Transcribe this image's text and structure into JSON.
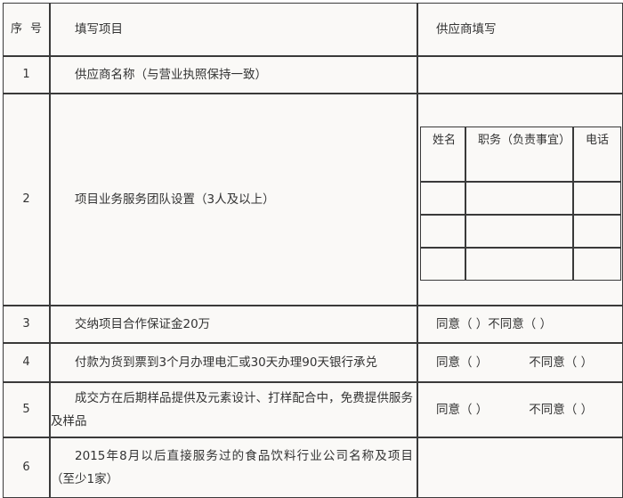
{
  "table": {
    "columns": {
      "seq_header": "序号",
      "item_header": "填写项目",
      "supplier_header": "供应商填写"
    },
    "rows": [
      {
        "seq": "1",
        "item": "供应商名称（与营业执照保持一致）",
        "supplier": ""
      },
      {
        "seq": "2",
        "item": "项目业务服务团队设置（3人及以上）",
        "supplier": ""
      },
      {
        "seq": "3",
        "item": "交纳项目合作保证金20万",
        "supplier": "同意（ ）不同意（ ）",
        "supplier_agree": "同意（ ）",
        "supplier_disagree": "不同意（ ）"
      },
      {
        "seq": "4",
        "item": "付款为货到票到3个月办理电汇或30天办理90天银行承兑",
        "supplier_agree": "同意（ ）",
        "supplier_disagree": "不同意（ ）"
      },
      {
        "seq": "5",
        "item": "成交方在后期样品提供及元素设计、打样配合中，免费提供服务及样品",
        "supplier_agree": "同意（ ）",
        "supplier_disagree": "不同意（ ）"
      },
      {
        "seq": "6",
        "item": "2015年8月以后直接服务过的食品饮料行业公司名称及项目（至少1家）",
        "supplier": ""
      }
    ],
    "team_table": {
      "headers": {
        "name": "姓名",
        "role": "职务（负责事宜）",
        "phone": "电话"
      },
      "rows": [
        {
          "name": "",
          "role": "",
          "phone": ""
        },
        {
          "name": "",
          "role": "",
          "phone": ""
        },
        {
          "name": "",
          "role": "",
          "phone": ""
        }
      ]
    }
  },
  "style": {
    "border_color": "#3a3a3a",
    "cell_background": "#faf9f7",
    "text_color": "#333333",
    "page_background": "#ffffff"
  }
}
